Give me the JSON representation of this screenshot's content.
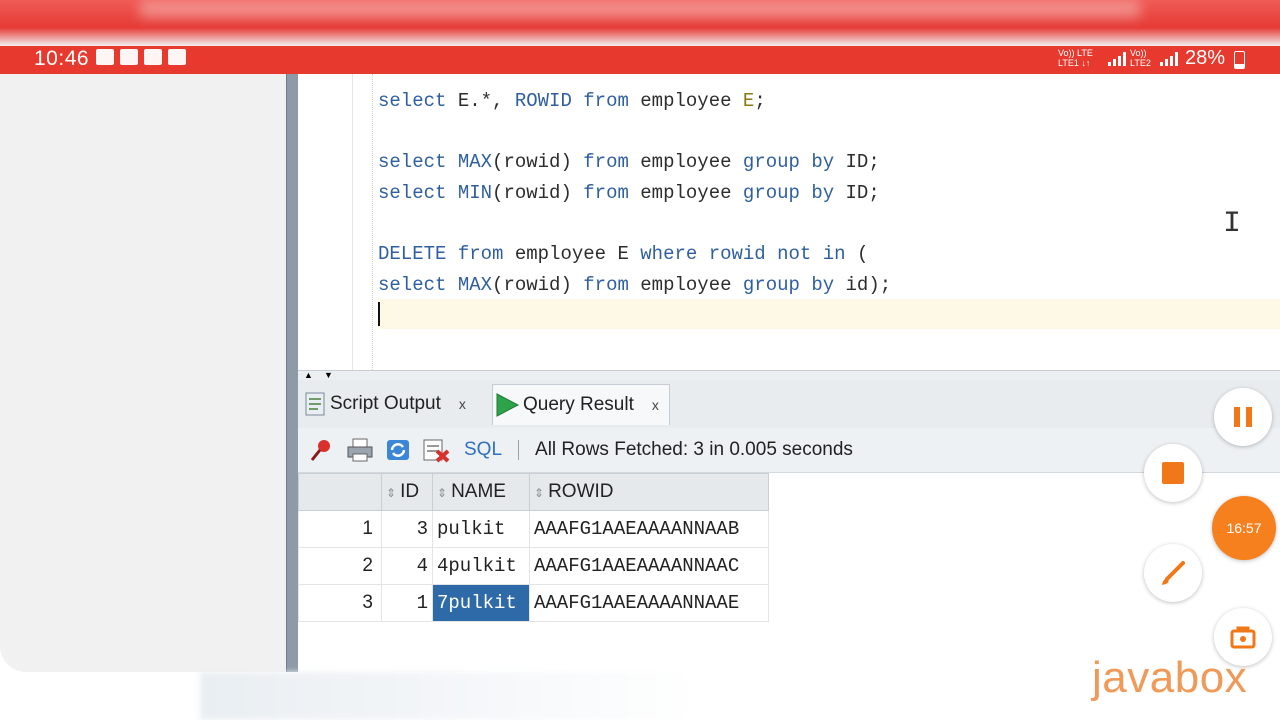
{
  "status_bar": {
    "time": "10:46",
    "net1": "Vo)) LTE\nLTE1 ↓↑",
    "net2": "Vo))\nLTE2",
    "battery": "28%"
  },
  "editor": {
    "lines": [
      [
        {
          "t": "select",
          "k": "kw"
        },
        {
          "t": " E.*, "
        },
        {
          "t": "ROWID",
          "k": "kw"
        },
        {
          "t": " "
        },
        {
          "t": "from",
          "k": "kw"
        },
        {
          "t": " employee "
        },
        {
          "t": "E",
          "k": "alias"
        },
        {
          "t": ";"
        }
      ],
      [],
      [
        {
          "t": "select",
          "k": "kw"
        },
        {
          "t": " "
        },
        {
          "t": "MAX",
          "k": "kw"
        },
        {
          "t": "(rowid) "
        },
        {
          "t": "from",
          "k": "kw"
        },
        {
          "t": " employee "
        },
        {
          "t": "group by",
          "k": "kw"
        },
        {
          "t": " ID;"
        }
      ],
      [
        {
          "t": "select",
          "k": "kw"
        },
        {
          "t": " "
        },
        {
          "t": "MIN",
          "k": "kw"
        },
        {
          "t": "(rowid) "
        },
        {
          "t": "from",
          "k": "kw"
        },
        {
          "t": " employee "
        },
        {
          "t": "group by",
          "k": "kw"
        },
        {
          "t": " ID;"
        }
      ],
      [],
      [
        {
          "t": "DELETE",
          "k": "kw"
        },
        {
          "t": " "
        },
        {
          "t": "from",
          "k": "kw"
        },
        {
          "t": " employee E "
        },
        {
          "t": "where",
          "k": "kw"
        },
        {
          "t": " "
        },
        {
          "t": "rowid",
          "k": "kw"
        },
        {
          "t": " "
        },
        {
          "t": "not",
          "k": "kw"
        },
        {
          "t": " "
        },
        {
          "t": "in",
          "k": "kw"
        },
        {
          "t": " ("
        }
      ],
      [
        {
          "t": "select",
          "k": "kw"
        },
        {
          "t": " "
        },
        {
          "t": "MAX",
          "k": "kw"
        },
        {
          "t": "(rowid) "
        },
        {
          "t": "from",
          "k": "kw"
        },
        {
          "t": " employee "
        },
        {
          "t": "group by",
          "k": "kw"
        },
        {
          "t": " id);"
        }
      ]
    ]
  },
  "tabs": {
    "script_output": "Script Output",
    "query_result": "Query Result",
    "close": "x"
  },
  "toolbar": {
    "sql_label": "SQL",
    "status": "All Rows Fetched: 3 in 0.005 seconds"
  },
  "grid": {
    "columns": [
      "ID",
      "NAME",
      "ROWID"
    ],
    "rows": [
      {
        "n": "1",
        "id": "3",
        "name": "pulkit",
        "rowid": "AAAFG1AAEAAAANNAAB"
      },
      {
        "n": "2",
        "id": "4",
        "name": "4pulkit",
        "rowid": "AAAFG1AAEAAAANNAAC"
      },
      {
        "n": "3",
        "id": "1",
        "name": "7pulkit",
        "rowid": "AAAFG1AAEAAAANNAAE"
      }
    ]
  },
  "recorder": {
    "timer": "16:57"
  },
  "watermark": "javabox",
  "colors": {
    "status_red": "#e8392f",
    "keyword_blue": "#2f5fa0",
    "selection_blue": "#2f6aa8",
    "recorder_orange": "#f7801e"
  }
}
